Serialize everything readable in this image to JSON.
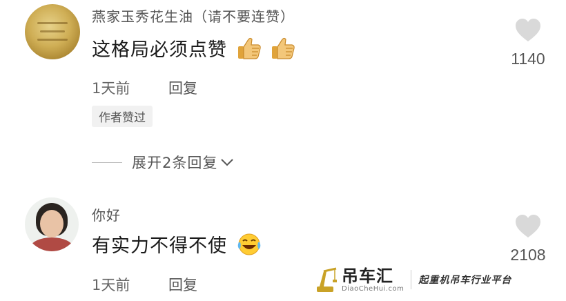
{
  "comments": [
    {
      "username": "燕家玉秀花生油（请不要连赞）",
      "text": "这格局必须点赞",
      "emojis": [
        "thumbs-up-icon",
        "thumbs-up-icon"
      ],
      "time": "1天前",
      "reply_label": "回复",
      "badge": "作者赞过",
      "likes": "1140",
      "expand_label": "展开2条回复"
    },
    {
      "username": "你好",
      "text": "有实力不得不使",
      "emojis": [
        "laughing-crying-icon"
      ],
      "time": "1天前",
      "reply_label": "回复",
      "likes": "2108"
    }
  ],
  "watermark": {
    "brand": "吊车汇",
    "url": "DiaoCheHui.com",
    "slogan": "起重机吊车行业平台"
  },
  "colors": {
    "text_primary": "#1a1a1a",
    "text_secondary": "#555555",
    "heart": "#d9d9d9",
    "badge_bg": "#f1f1f1",
    "brand_gold": "#c9a227"
  }
}
